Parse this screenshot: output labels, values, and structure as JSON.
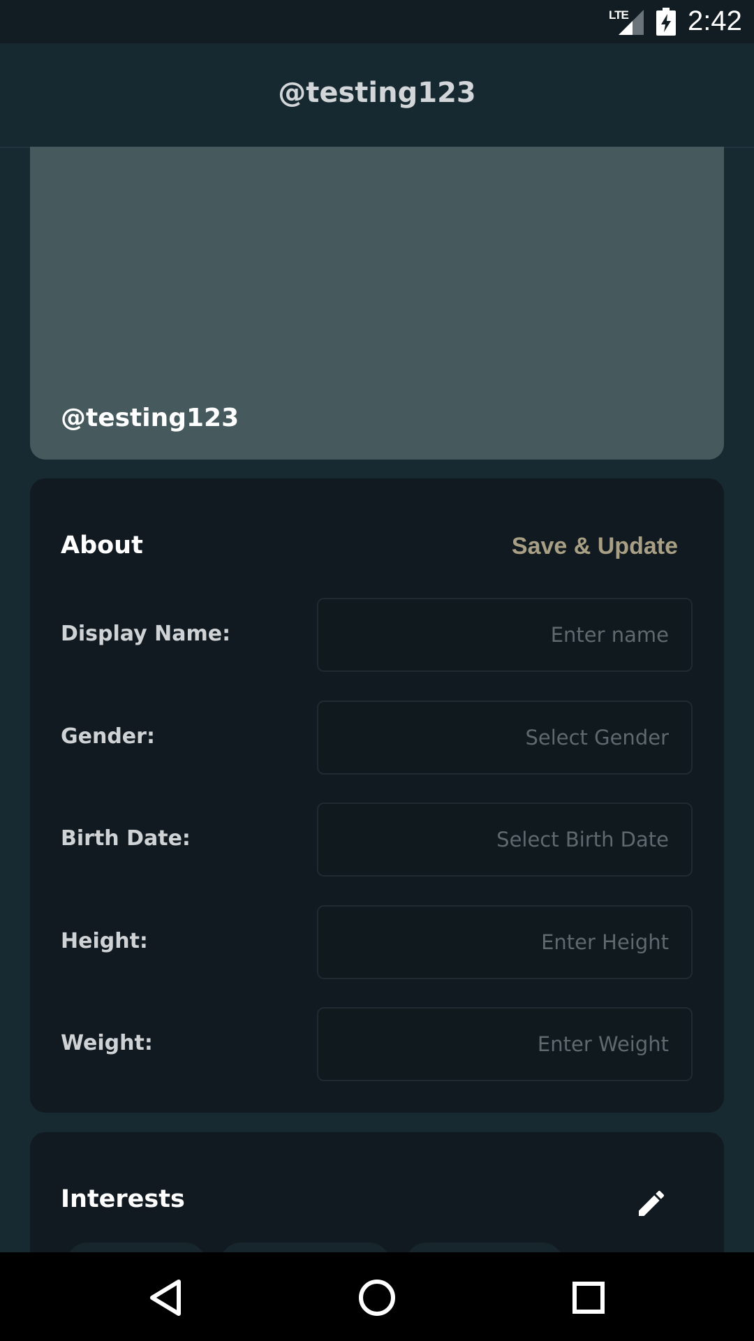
{
  "status_bar": {
    "network_label": "LTE",
    "time": "2:42",
    "icons": [
      "signal-icon",
      "battery-charging-icon"
    ]
  },
  "app_bar": {
    "title": "@testing123"
  },
  "profile_cover": {
    "username": "@testing123"
  },
  "about": {
    "heading": "About",
    "save_label": "Save & Update",
    "fields": [
      {
        "label": "Display Name:",
        "placeholder": "Enter name"
      },
      {
        "label": "Gender:",
        "placeholder": "Select Gender"
      },
      {
        "label": "Birth Date:",
        "placeholder": "Select Birth Date"
      },
      {
        "label": "Height:",
        "placeholder": "Enter Height"
      },
      {
        "label": "Weight:",
        "placeholder": "Enter Weight"
      }
    ]
  },
  "interests": {
    "heading": "Interests",
    "edit_icon": "pencil-icon"
  },
  "nav_bar": {
    "icons": [
      "back-icon",
      "home-icon",
      "recents-icon"
    ]
  },
  "colors": {
    "background": "#182a31",
    "card": "#111a20",
    "cover": "#465a5e",
    "accent": "#a89f84"
  }
}
